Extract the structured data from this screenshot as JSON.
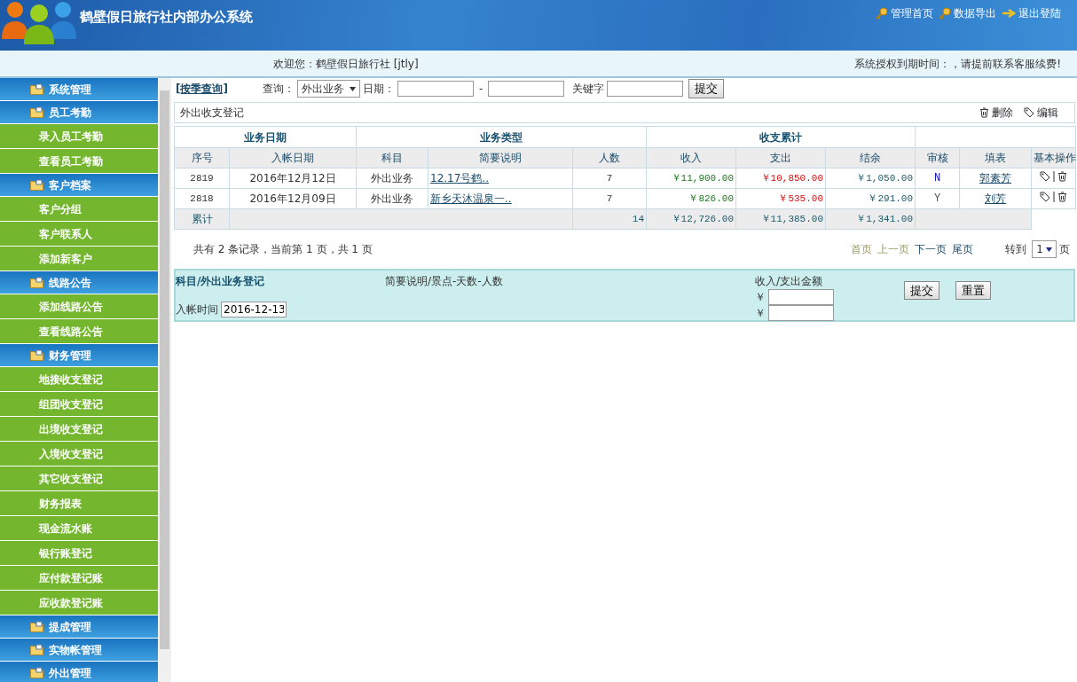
{
  "header": {
    "title": "鹤壁假日旅行社内部办公系统",
    "links": [
      {
        "label": "管理首页"
      },
      {
        "label": "数据导出"
      },
      {
        "label": "退出登陆"
      }
    ]
  },
  "welcome_bar": {
    "welcome": "欢迎您：鹤壁假日旅行社 [jtly]",
    "notice": "系统授权到期时间：，请提前联系客服续费!"
  },
  "sidebar": {
    "items": [
      {
        "label": "系统管理"
      },
      {
        "label": "员工考勤",
        "children": [
          {
            "label": "录入员工考勤"
          },
          {
            "label": "查看员工考勤"
          }
        ]
      },
      {
        "label": "客户档案",
        "children": [
          {
            "label": "客户分组"
          },
          {
            "label": "客户联系人"
          },
          {
            "label": "添加新客户"
          }
        ]
      },
      {
        "label": "线路公告",
        "children": [
          {
            "label": "添加线路公告"
          },
          {
            "label": "查看线路公告"
          }
        ]
      },
      {
        "label": "财务管理",
        "children": [
          {
            "label": "地接收支登记"
          },
          {
            "label": "组团收支登记"
          },
          {
            "label": "出境收支登记"
          },
          {
            "label": "入境收支登记"
          },
          {
            "label": "其它收支登记"
          },
          {
            "label": "财务报表"
          },
          {
            "label": "现金流水账"
          },
          {
            "label": "银行账登记"
          },
          {
            "label": "应付款登记账"
          },
          {
            "label": "应收款登记账"
          }
        ]
      },
      {
        "label": "提成管理"
      },
      {
        "label": "实物帐管理"
      },
      {
        "label": "外出管理"
      }
    ]
  },
  "query_bar": {
    "season_link": "[按季查询]",
    "query_label": "查询：",
    "query_value": "外出业务",
    "date_label": "日期：",
    "date_separator": "-",
    "keyword_label": "关键字",
    "submit": "提交"
  },
  "panel": {
    "title": "外出收支登记",
    "actions": [
      {
        "label": "删除"
      },
      {
        "label": "编辑"
      }
    ]
  },
  "table": {
    "groups": [
      "业务日期",
      "业务类型",
      "收支累计"
    ],
    "columns": [
      "序号",
      "入帐日期",
      "科目",
      "简要说明",
      "人数",
      "收入",
      "支出",
      "结余",
      "审核",
      "填表",
      "基本操作"
    ],
    "rows": [
      {
        "cells": [
          "2819",
          "2016年12月12日",
          "外出业务",
          "12.17号鹤..",
          "7",
          "￥11,900.00",
          "￥10,850.00",
          "￥1,050.00",
          "N",
          "郭素芳"
        ]
      },
      {
        "cells": [
          "2818",
          "2016年12月09日",
          "外出业务",
          "新乡天沐温泉一..",
          "7",
          "￥826.00",
          "￥535.00",
          "￥291.00",
          "Y",
          "刘芳"
        ]
      }
    ],
    "total": {
      "label": "累计",
      "people": "14",
      "income": "￥12,726.00",
      "expense": "￥11,385.00",
      "balance": "￥1,341.00"
    }
  },
  "pager": {
    "summary": "共有 2 条记录，当前第 1 页，共 1 页",
    "links": [
      {
        "label": "首页",
        "disabled": true
      },
      {
        "label": "上一页",
        "disabled": true
      },
      {
        "label": "下一页",
        "disabled": false
      },
      {
        "label": "尾页",
        "disabled": false
      }
    ],
    "goto_label": "转到",
    "page_value": "1",
    "page_suffix": "页"
  },
  "form": {
    "title": "科目/外出业务登记",
    "desc_label": "简要说明/景点-天数-人数",
    "amount_label": "收入/支出金额",
    "date_label": "入帐时间",
    "date_value": "2016-12-13",
    "currency": [
      "￥",
      "￥"
    ],
    "buttons": [
      "提交",
      "重置"
    ]
  }
}
